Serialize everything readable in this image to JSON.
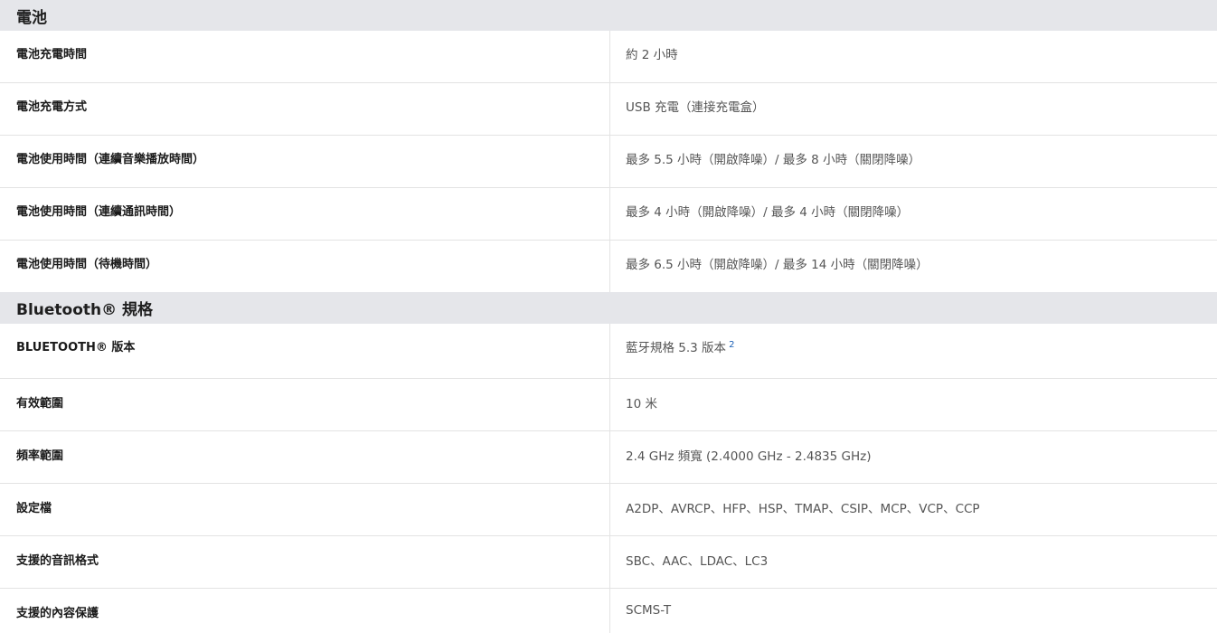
{
  "sections": [
    {
      "title": "電池",
      "rows": [
        {
          "label": "電池充電時間",
          "value": "約 2 小時"
        },
        {
          "label": "電池充電方式",
          "value": "USB 充電（連接充電盒）"
        },
        {
          "label": "電池使用時間（連續音樂播放時間）",
          "value": "最多 5.5 小時（開啟降噪）/ 最多 8 小時（關閉降噪）"
        },
        {
          "label": "電池使用時間（連續通訊時間）",
          "value": "最多 4 小時（開啟降噪）/ 最多 4 小時（關閉降噪）"
        },
        {
          "label": "電池使用時間（待機時間）",
          "value": "最多 6.5 小時（開啟降噪）/ 最多 14 小時（關閉降噪）"
        }
      ]
    },
    {
      "title": "Bluetooth® 規格",
      "rows": [
        {
          "label": "BLUETOOTH® 版本",
          "value": "藍牙規格 5.3 版本",
          "footnote": "2"
        },
        {
          "label": "有效範圍",
          "value": "10 米"
        },
        {
          "label": "頻率範圍",
          "value": "2.4 GHz 頻寬 (2.4000 GHz - 2.4835 GHz)"
        },
        {
          "label": "設定檔",
          "value": "A2DP、AVRCP、HFP、HSP、TMAP、CSIP、MCP、VCP、CCP"
        },
        {
          "label": "支援的音訊格式",
          "value": "SBC、AAC、LDAC、LC3"
        },
        {
          "label": "支援的內容保護",
          "value": "SCMS-T"
        }
      ]
    }
  ]
}
